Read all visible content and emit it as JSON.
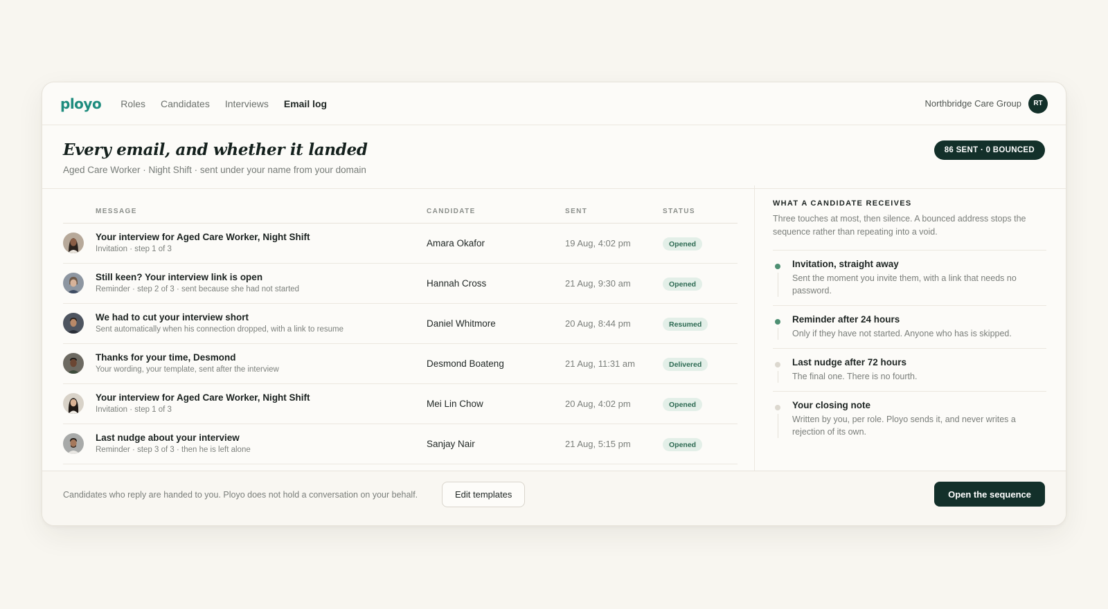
{
  "nav": {
    "logo": "ployo",
    "links": [
      "Roles",
      "Candidates",
      "Interviews",
      "Email log"
    ],
    "active": "Email log",
    "org": "Northbridge Care Group",
    "avatar_initials": "RT"
  },
  "header": {
    "title": "Every email, and whether it landed",
    "subtitle": "Aged Care Worker · Night Shift · sent under your name from your domain",
    "pill": "86 SENT · 0 BOUNCED"
  },
  "table": {
    "columns": [
      "MESSAGE",
      "CANDIDATE",
      "SENT",
      "STATUS"
    ],
    "rows": [
      {
        "title": "Your interview for Aged Care Worker, Night Shift",
        "meta": "Invitation · step 1 of 3",
        "candidate": "Amara Okafor",
        "sent": "19 Aug, 4:02 pm",
        "status": "Opened"
      },
      {
        "title": "Still keen? Your interview link is open",
        "meta": "Reminder · step 2 of 3 · sent because she had not started",
        "candidate": "Hannah Cross",
        "sent": "21 Aug, 9:30 am",
        "status": "Opened"
      },
      {
        "title": "We had to cut your interview short",
        "meta": "Sent automatically when his connection dropped, with a link to resume",
        "candidate": "Daniel Whitmore",
        "sent": "20 Aug, 8:44 pm",
        "status": "Resumed"
      },
      {
        "title": "Thanks for your time, Desmond",
        "meta": "Your wording, your template, sent after the interview",
        "candidate": "Desmond Boateng",
        "sent": "21 Aug, 11:31 am",
        "status": "Delivered"
      },
      {
        "title": "Your interview for Aged Care Worker, Night Shift",
        "meta": "Invitation · step 1 of 3",
        "candidate": "Mei Lin Chow",
        "sent": "20 Aug, 4:02 pm",
        "status": "Opened"
      },
      {
        "title": "Last nudge about your interview",
        "meta": "Reminder · step 3 of 3 · then he is left alone",
        "candidate": "Sanjay Nair",
        "sent": "21 Aug, 5:15 pm",
        "status": "Opened"
      }
    ]
  },
  "side": {
    "heading": "WHAT A CANDIDATE RECEIVES",
    "desc": "Three touches at most, then silence. A bounced address stops the sequence rather than repeating into a void.",
    "steps": [
      {
        "title": "Invitation, straight away",
        "desc": "Sent the moment you invite them, with a link that needs no password.",
        "state": "done"
      },
      {
        "title": "Reminder after 24 hours",
        "desc": "Only if they have not started. Anyone who has is skipped.",
        "state": "done"
      },
      {
        "title": "Last nudge after 72 hours",
        "desc": "The final one. There is no fourth.",
        "state": "pending"
      },
      {
        "title": "Your closing note",
        "desc": "Written by you, per role. Ployo sends it, and never writes a rejection of its own.",
        "state": "pending"
      }
    ]
  },
  "footer": {
    "note": "Candidates who reply are handed to you. Ployo does not hold a conversation on your behalf.",
    "edit_label": "Edit templates",
    "open_label": "Open the sequence"
  },
  "colors": {
    "brand": "#1e8c7e",
    "dark": "#13302a",
    "badge_bg": "#e3efe8",
    "badge_text": "#2d6a52"
  }
}
